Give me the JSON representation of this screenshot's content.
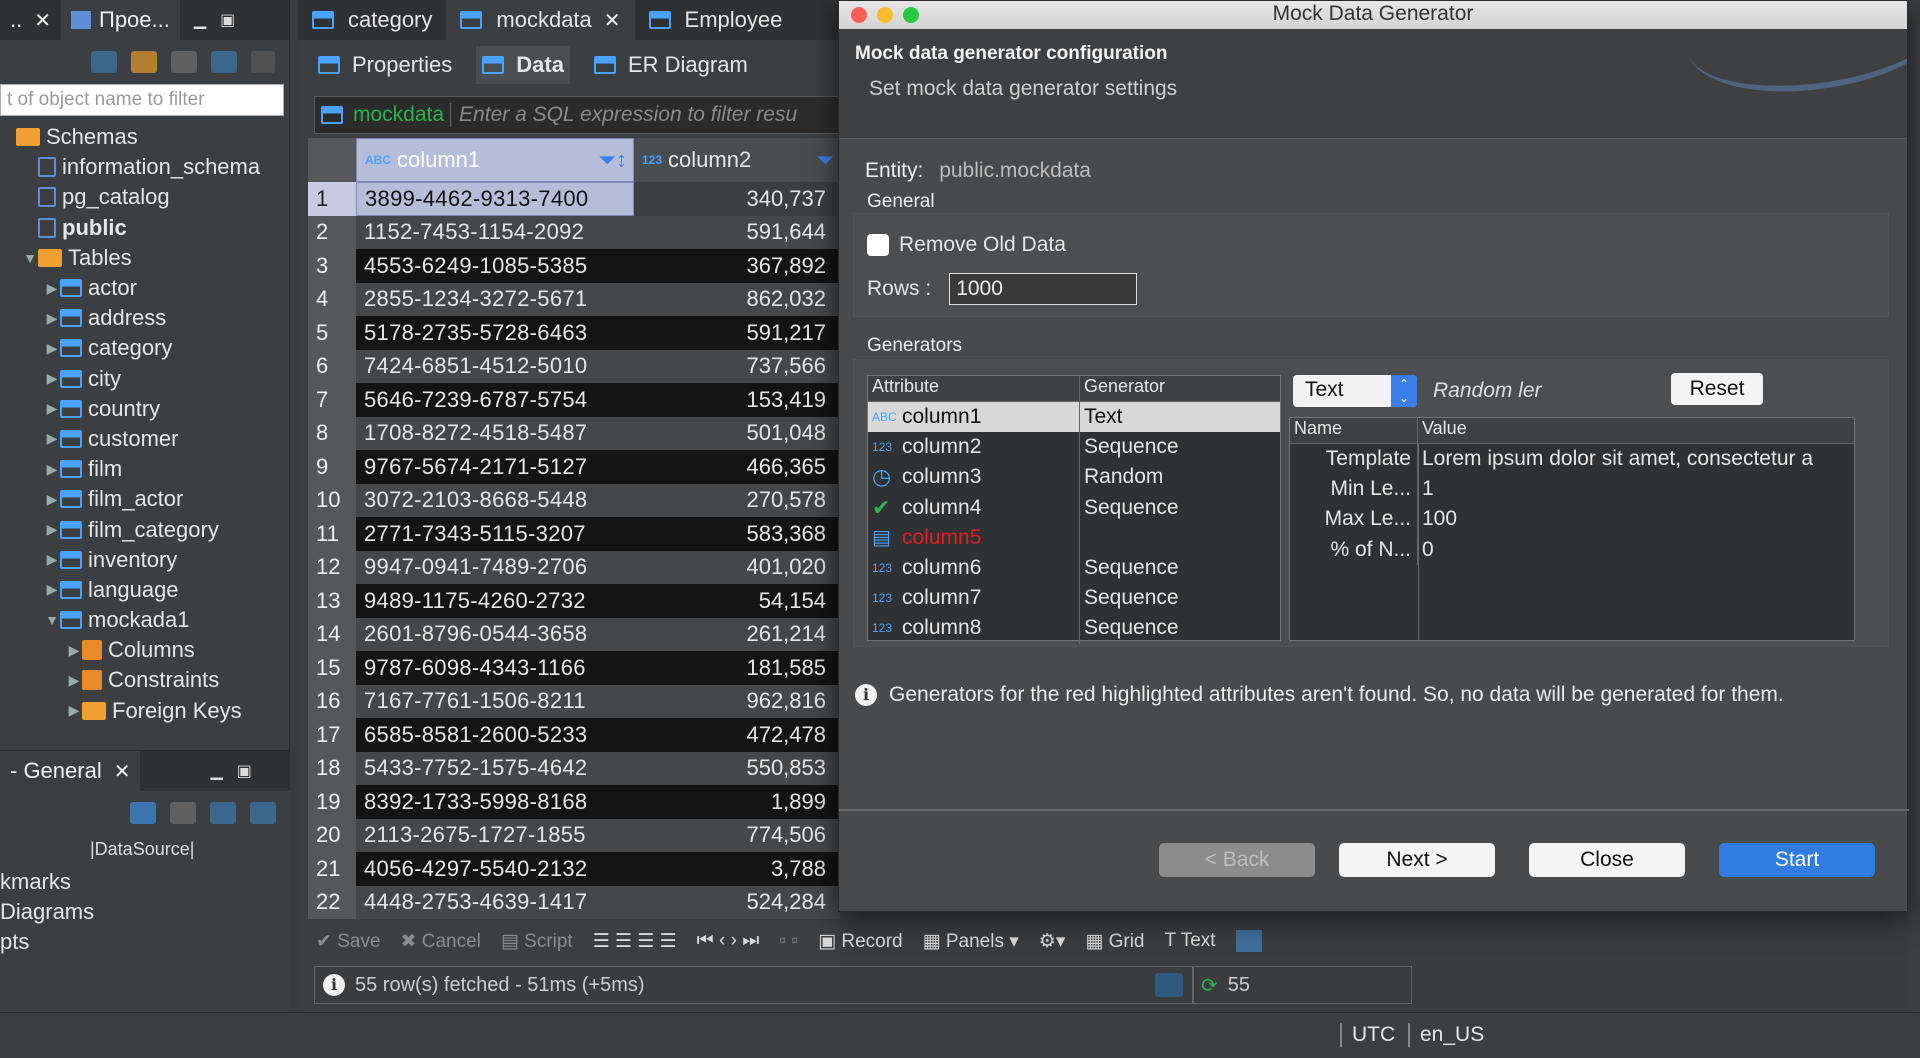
{
  "left_panel": {
    "tab_label": "Прое...",
    "filter_placeholder": "t of object name to filter",
    "tree": [
      {
        "label": "Schemas",
        "indent": 0,
        "icon": "folder",
        "arrow": ""
      },
      {
        "label": "information_schema",
        "indent": 1,
        "icon": "schema",
        "arrow": ""
      },
      {
        "label": "pg_catalog",
        "indent": 1,
        "icon": "schema",
        "arrow": ""
      },
      {
        "label": "public",
        "indent": 1,
        "icon": "schema",
        "arrow": "",
        "bold": true
      },
      {
        "label": "Tables",
        "indent": 1,
        "icon": "folder",
        "arrow": "▼"
      },
      {
        "label": "actor",
        "indent": 2,
        "icon": "table",
        "arrow": "▶"
      },
      {
        "label": "address",
        "indent": 2,
        "icon": "table",
        "arrow": "▶"
      },
      {
        "label": "category",
        "indent": 2,
        "icon": "table",
        "arrow": "▶"
      },
      {
        "label": "city",
        "indent": 2,
        "icon": "table",
        "arrow": "▶"
      },
      {
        "label": "country",
        "indent": 2,
        "icon": "table",
        "arrow": "▶"
      },
      {
        "label": "customer",
        "indent": 2,
        "icon": "table",
        "arrow": "▶"
      },
      {
        "label": "film",
        "indent": 2,
        "icon": "table",
        "arrow": "▶"
      },
      {
        "label": "film_actor",
        "indent": 2,
        "icon": "table",
        "arrow": "▶"
      },
      {
        "label": "film_category",
        "indent": 2,
        "icon": "table",
        "arrow": "▶"
      },
      {
        "label": "inventory",
        "indent": 2,
        "icon": "table",
        "arrow": "▶"
      },
      {
        "label": "language",
        "indent": 2,
        "icon": "table",
        "arrow": "▶"
      },
      {
        "label": "mockada1",
        "indent": 2,
        "icon": "table",
        "arrow": "▼"
      },
      {
        "label": "Columns",
        "indent": 3,
        "icon": "columns",
        "arrow": "▶"
      },
      {
        "label": "Constraints",
        "indent": 3,
        "icon": "columns",
        "arrow": "▶"
      },
      {
        "label": "Foreign Keys",
        "indent": 3,
        "icon": "folder",
        "arrow": "▶"
      }
    ],
    "bottom_tab_label": "- General",
    "datasource_header": "|DataSource|",
    "bottom_items": [
      "kmarks",
      "Diagrams",
      "pts"
    ]
  },
  "editor": {
    "tabs": [
      "category",
      "mockdata",
      "Employee"
    ],
    "active_tab": "mockdata",
    "sub_tabs": [
      "Properties",
      "Data",
      "ER Diagram"
    ],
    "active_sub_tab": "Data",
    "filter_table": "mockdata",
    "filter_placeholder": "Enter a SQL expression to filter resu",
    "columns": [
      "column1",
      "column2"
    ],
    "rows": [
      [
        "1",
        "3899-4462-9313-7400",
        "340,737"
      ],
      [
        "2",
        "1152-7453-1154-2092",
        "591,644"
      ],
      [
        "3",
        "4553-6249-1085-5385",
        "367,892"
      ],
      [
        "4",
        "2855-1234-3272-5671",
        "862,032"
      ],
      [
        "5",
        "5178-2735-5728-6463",
        "591,217"
      ],
      [
        "6",
        "7424-6851-4512-5010",
        "737,566"
      ],
      [
        "7",
        "5646-7239-6787-5754",
        "153,419"
      ],
      [
        "8",
        "1708-8272-4518-5487",
        "501,048"
      ],
      [
        "9",
        "9767-5674-2171-5127",
        "466,365"
      ],
      [
        "10",
        "3072-2103-8668-5448",
        "270,578"
      ],
      [
        "11",
        "2771-7343-5115-3207",
        "583,368"
      ],
      [
        "12",
        "9947-0941-7489-2706",
        "401,020"
      ],
      [
        "13",
        "9489-1175-4260-2732",
        "54,154"
      ],
      [
        "14",
        "2601-8796-0544-3658",
        "261,214"
      ],
      [
        "15",
        "9787-6098-4343-1166",
        "181,585"
      ],
      [
        "16",
        "7167-7761-1506-8211",
        "962,816"
      ],
      [
        "17",
        "6585-8581-2600-5233",
        "472,478"
      ],
      [
        "18",
        "5433-7752-1575-4642",
        "550,853"
      ],
      [
        "19",
        "8392-1733-5998-8168",
        "1,899"
      ],
      [
        "20",
        "2113-2675-1727-1855",
        "774,506"
      ],
      [
        "21",
        "4056-4297-5540-2132",
        "3,788"
      ],
      [
        "22",
        "4448-2753-4639-1417",
        "524,284"
      ]
    ],
    "toolbar": {
      "save": "Save",
      "cancel": "Cancel",
      "script": "Script",
      "record": "Record",
      "panels": "Panels",
      "grid": "Grid",
      "text": "Text"
    },
    "status": "55 row(s) fetched - 51ms (+5ms)",
    "row_count": "55"
  },
  "footer": {
    "timezone": "UTC",
    "locale": "en_US"
  },
  "dialog": {
    "window_title": "Mock Data Generator",
    "header_title": "Mock data generator configuration",
    "header_subtitle": "Set mock data generator settings",
    "entity_label": "Entity:",
    "entity_value": "public.mockdata",
    "general_label": "General",
    "remove_old_data_label": "Remove Old Data",
    "remove_old_data_checked": false,
    "rows_label": "Rows :",
    "rows_value": "1000",
    "generators_label": "Generators",
    "attr_headers": [
      "Attribute",
      "Generator"
    ],
    "attributes": [
      {
        "type": "ABC",
        "name": "column1",
        "generator": "Text",
        "selected": true
      },
      {
        "type": "123",
        "name": "column2",
        "generator": "Sequence"
      },
      {
        "type": "clock",
        "name": "column3",
        "generator": "Random"
      },
      {
        "type": "check",
        "name": "column4",
        "generator": "Sequence"
      },
      {
        "type": "doc",
        "name": "column5",
        "generator": "",
        "missing": true
      },
      {
        "type": "123",
        "name": "column6",
        "generator": "Sequence"
      },
      {
        "type": "123",
        "name": "column7",
        "generator": "Sequence"
      },
      {
        "type": "123",
        "name": "column8",
        "generator": "Sequence"
      }
    ],
    "generator_select": "Text",
    "generator_desc": "Random ler",
    "reset_label": "Reset",
    "prop_headers": [
      "Name",
      "Value"
    ],
    "properties": [
      {
        "name": "Template",
        "value": "Lorem ipsum dolor sit amet, consectetur a"
      },
      {
        "name": "Min Le...",
        "value": "1"
      },
      {
        "name": "Max Le...",
        "value": "100"
      },
      {
        "name": "% of N...",
        "value": "0"
      }
    ],
    "info_text": "Generators for the red highlighted attributes aren't found. So, no data will be generated for them.",
    "buttons": {
      "back": "< Back",
      "next": "Next >",
      "close": "Close",
      "start": "Start"
    }
  }
}
